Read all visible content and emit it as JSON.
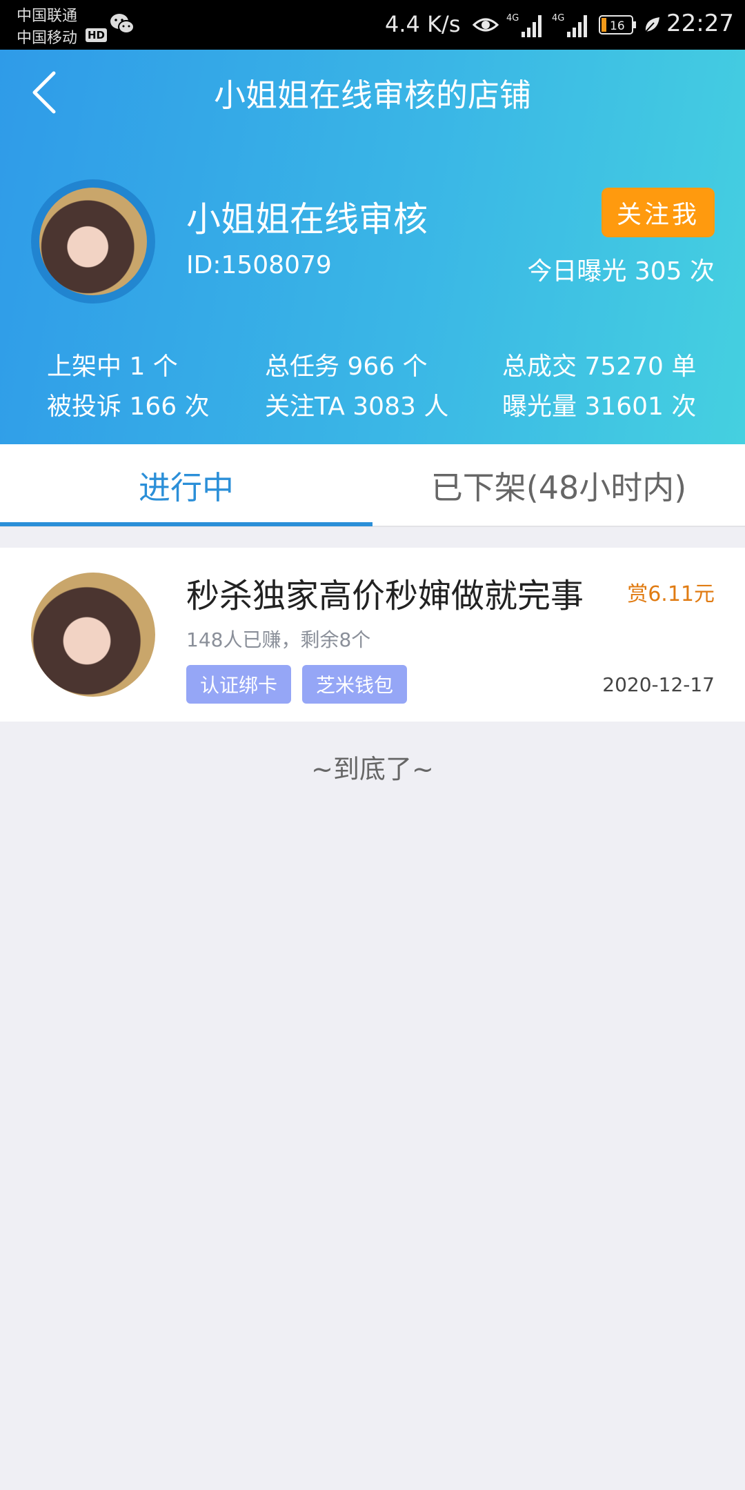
{
  "status_bar": {
    "carrier_1": "中国联通",
    "carrier_2": "中国移动",
    "hd_badge": "HD",
    "net_speed": "4.4 K/s",
    "signal_1_label": "4G",
    "signal_2_label": "4G",
    "battery": "16",
    "time": "22:27"
  },
  "header": {
    "title": "小姐姐在线审核的店铺",
    "shop_name": "小姐姐在线审核",
    "shop_id": "ID:1508079",
    "follow_label": "关注我",
    "exposure_today": "今日曝光 305 次",
    "stats": {
      "listed": "上架中 1 个",
      "total_tasks": "总任务 966 个",
      "total_deals": "总成交 75270 单",
      "complaints": "被投诉 166 次",
      "followers": "关注TA 3083 人",
      "exposure": "曝光量 31601 次"
    }
  },
  "tabs": [
    {
      "label": "进行中",
      "active": true
    },
    {
      "label": "已下架(48小时内)",
      "active": false
    }
  ],
  "tasks": [
    {
      "title": "秒杀独家高价秒婶做就完事",
      "reward": "赏6.11元",
      "subtitle": "148人已赚，剩余8个",
      "tags": [
        "认证绑卡",
        "芝米钱包"
      ],
      "date": "2020-12-17"
    }
  ],
  "list_end": "~到底了~",
  "colors": {
    "header_gradient_start": "#2f9be8",
    "header_gradient_end": "#45d0e0",
    "follow_button": "#ff9a0e",
    "active_tab": "#2b8fd8",
    "reward": "#e07b12",
    "tag": "#95a6f6"
  }
}
